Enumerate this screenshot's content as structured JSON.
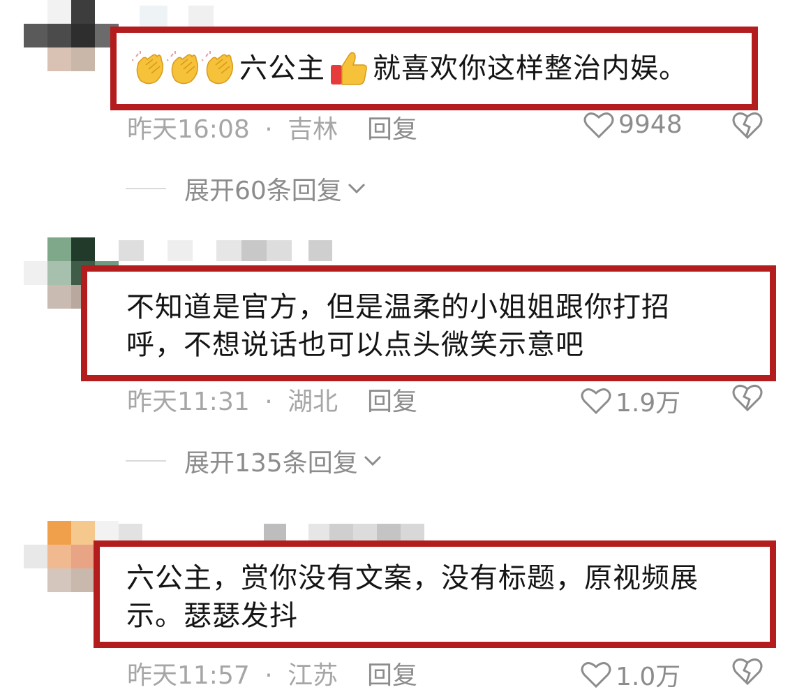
{
  "comments": [
    {
      "text_prefix": "六公主",
      "text_suffix": "就喜欢你这样整治内娱。",
      "emoji_prefix": [
        "clapping-hands",
        "clapping-hands",
        "clapping-hands"
      ],
      "emoji_mid": "thumbs-up",
      "time": "昨天16:08",
      "separator": "·",
      "location": "吉林",
      "reply_label": "回复",
      "likes": "9948",
      "expand_label": "展开60条回复"
    },
    {
      "line1": "不知道是官方，但是温柔的小姐姐跟你打招",
      "line2": "呼，不想说话也可以点头微笑示意吧",
      "time": "昨天11:31",
      "separator": "·",
      "location": "湖北",
      "reply_label": "回复",
      "likes": "1.9万",
      "expand_label": "展开135条回复"
    },
    {
      "line1": "六公主，赏你没有文案，没有标题，原视频展",
      "line2": "示。瑟瑟发抖",
      "time": "昨天11:57",
      "separator": "·",
      "location": "江苏",
      "reply_label": "回复",
      "likes": "1.0万"
    }
  ],
  "colors": {
    "highlight_border": "#b31d1d",
    "meta_text": "#a6a6a6",
    "secondary_text": "#8c8c8c"
  },
  "icons": {
    "like": "heart-outline-icon",
    "dislike": "broken-heart-icon",
    "expand": "chevron-down-icon"
  }
}
